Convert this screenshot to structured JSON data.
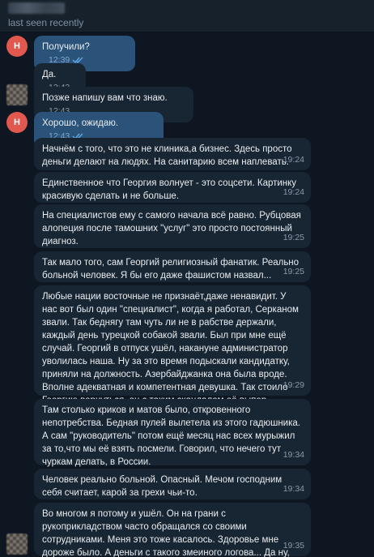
{
  "header": {
    "status": "last seen recently"
  },
  "avatars": {
    "initial": "H"
  },
  "messages": [
    {
      "text": "Получили?",
      "time": "12:39"
    },
    {
      "text": "Да.",
      "time": "12:42"
    },
    {
      "text": "Позже напишу вам что знаю.",
      "time": "12:43"
    },
    {
      "text": "Хорошо, ожидаю.",
      "time": "12:43"
    },
    {
      "text": "Начнём с того, что это не клиника,а бизнес. Здесь просто деньги делают на людях. На санитарию всем наплевать.",
      "time": "19:24"
    },
    {
      "text": "Единственное что Георгия волнует - это соцсети. Картинку красивую сделать и не больше.",
      "time": "19:24"
    },
    {
      "text": "На специалистов ему с самого начала всё равно. Рубцовая алопеция после тамошних \"услуг\" это просто постоянный диагноз.",
      "time": "19:25"
    },
    {
      "text": "Так мало того, сам Георгий религиозный фанатик. Реально больной человек. Я бы его даже фашистом назвал...",
      "time": "19:25"
    },
    {
      "text": "Любые нации восточные не признаёт,даже ненавидит. У нас вот был один \"специалист\", когда я работал, Серканом звали. Так беднягу там чуть ли не в рабстве держали, каждый день турецкой собакой звали. Был при мне ещё случай. Георгий в отпуск ушёл, накануне администратор уволилась наша. Ну за это время подыскали кандидатку, приняли на должность. Азербайджанка она была вроде. Вполне адекватная и компетентная девушка. Так стоило Георгию вернуться, он с таким скандалом её выпер...",
      "time": "19:29"
    },
    {
      "text": "Там столько криков и матов было, откровенного непотребства. Бедная пулей вылетела из этого гадюшника. А сам \"руководитель\" потом ещё месяц нас всех мурыжил за то,что мы её взять посмели. Говорил, что нечего тут чуркам делать, в России.",
      "time": "19:34"
    },
    {
      "text": "Человек реально больной. Опасный. Мечом господним себя считает, карой за грехи чьи-то.",
      "time": "19:34"
    },
    {
      "text": "Во многом я потому и ушёл. Он на грани с рукоприкладством часто обращался со своими сотрудниками. Меня это тоже касалось. Здоровье мне дороже было. А деньги с такого змеиного логова... Да ну, себе дороже.",
      "time": "19:35"
    }
  ],
  "colors": {
    "background": "#0e1621",
    "header": "#17212b",
    "outgoing_bubble": "#2b5278",
    "incoming_bubble": "#182533",
    "avatar": "#e1584f",
    "read_check": "#5ea9e6"
  },
  "icons": {
    "read_receipt": "double-check-icon"
  }
}
